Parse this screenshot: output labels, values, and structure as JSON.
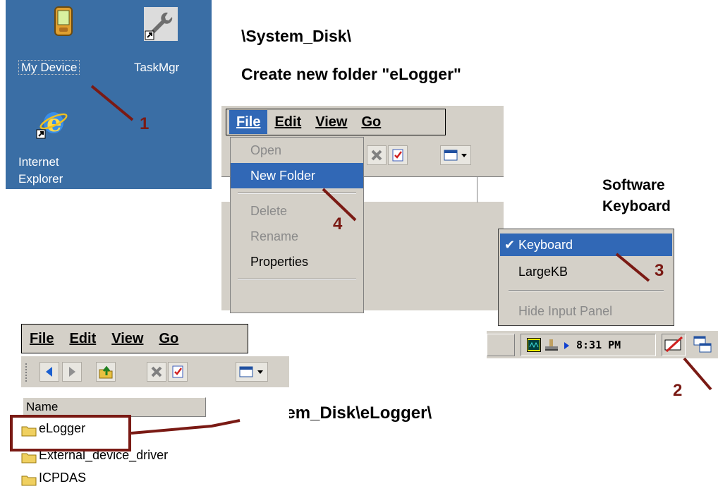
{
  "desktop": {
    "icons": [
      {
        "label": "My Device",
        "icon": "pda-device-icon"
      },
      {
        "label": "TaskMgr",
        "icon": "wrench-icon"
      },
      {
        "label": "Internet Explorer",
        "icon": "internet-explorer-icon"
      }
    ]
  },
  "headings": {
    "path": "\\System_Disk\\",
    "create": "Create new folder  \"eLogger\"",
    "keyboard_line1": "Software",
    "keyboard_line2": "Keyboard",
    "result_path": "\\System_Disk\\eLogger\\"
  },
  "menu_panel": {
    "menus": [
      "File",
      "Edit",
      "View",
      "Go"
    ],
    "active_menu": "File",
    "file_items": [
      {
        "label": "Open",
        "state": "disabled"
      },
      {
        "label": "New Folder",
        "state": "selected"
      },
      {
        "label": "Delete",
        "state": "disabled"
      },
      {
        "label": "Rename",
        "state": "disabled"
      },
      {
        "label": "Properties",
        "state": "enabled"
      }
    ]
  },
  "keyboard_popup": {
    "items": [
      {
        "label": "Keyboard",
        "checked": true,
        "state": "selected"
      },
      {
        "label": "LargeKB",
        "checked": false,
        "state": "enabled"
      },
      {
        "label": "Hide Input Panel",
        "checked": false,
        "state": "disabled"
      }
    ]
  },
  "taskbar": {
    "clock": "8:31 PM"
  },
  "explorer": {
    "menus": [
      "File",
      "Edit",
      "View",
      "Go"
    ],
    "column_header": "Name",
    "folders": [
      "eLogger",
      "External_device_driver",
      "ICPDAS"
    ]
  },
  "steps": [
    "1",
    "2",
    "3",
    "4"
  ],
  "colors": {
    "desktop_bg": "#3a6ea5",
    "highlight": "#3168b6",
    "annotation": "#7a1a14",
    "chrome": "#d4d0c8"
  }
}
